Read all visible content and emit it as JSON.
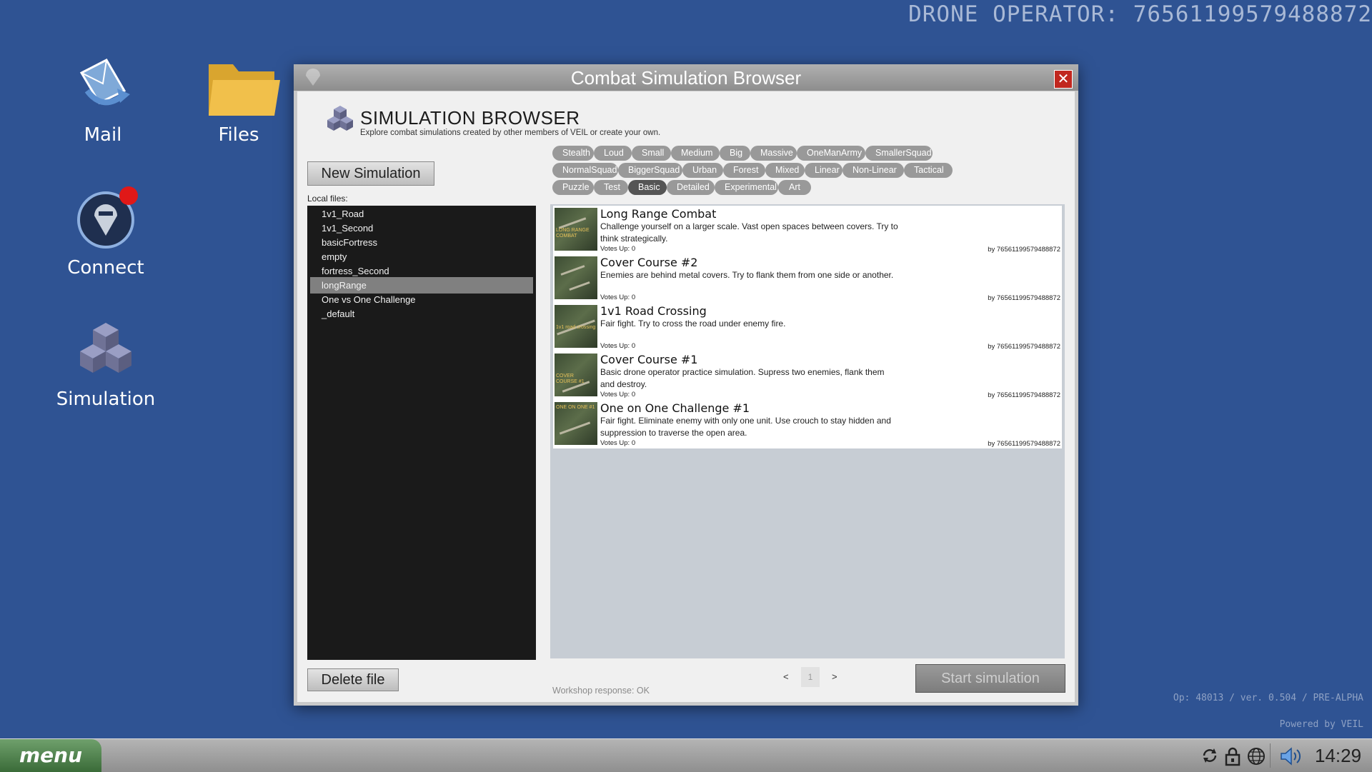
{
  "operator_id": "DRONE OPERATOR: 76561199579488872",
  "version_info": "Op: 48013 / ver. 0.504 / PRE-ALPHA",
  "powered_by": "Powered by VEIL",
  "desktop_icons": {
    "mail": "Mail",
    "files": "Files",
    "connect": "Connect",
    "simulation": "Simulation"
  },
  "window": {
    "title": "Combat Simulation Browser",
    "close_glyph": "✕",
    "header_title": "SIMULATION BROWSER",
    "header_subtitle": "Explore combat simulations created by other members of VEIL or create your own."
  },
  "new_simulation_label": "New Simulation",
  "local_files_label": "Local files:",
  "local_files": [
    "1v1_Road",
    "1v1_Second",
    "basicFortress",
    "empty",
    "fortress_Second",
    "longRange",
    "One vs One Challenge",
    "_default"
  ],
  "selected_file": "longRange",
  "tags": [
    "Stealth",
    "Loud",
    "Small",
    "Medium",
    "Big",
    "Massive",
    "OneManArmy",
    "SmallerSquad",
    "NormalSquad",
    "BiggerSquad",
    "Urban",
    "Forest",
    "Mixed",
    "Linear",
    "Non-Linear",
    "Tactical",
    "Puzzle",
    "Test",
    "Basic",
    "Detailed",
    "Experimental",
    "Art"
  ],
  "active_tag": "Basic",
  "results": [
    {
      "title": "Long Range Combat",
      "description": "Challenge yourself on a larger scale. Vast open spaces between covers. Try to think strategically.",
      "votes": "Votes Up: 0",
      "author": "by 76561199579488872",
      "thumb_text": "LONG RANGE COMBAT"
    },
    {
      "title": "Cover Course #2",
      "description": "Enemies are behind metal covers. Try to flank them from one side or another.",
      "votes": "Votes Up: 0",
      "author": "by 76561199579488872",
      "thumb_text": ""
    },
    {
      "title": "1v1 Road Crossing",
      "description": "Fair fight. Try to cross the road under enemy fire.",
      "votes": "Votes Up: 0",
      "author": "by 76561199579488872",
      "thumb_text": "1v1 road crossing"
    },
    {
      "title": "Cover Course #1",
      "description": "Basic drone operator practice simulation. Supress two enemies, flank them and destroy.",
      "votes": "Votes Up: 0",
      "author": "by 76561199579488872",
      "thumb_text": "COVER COURSE #1"
    },
    {
      "title": "One on One Challenge #1",
      "description": "Fair fight. Eliminate enemy with only one unit. Use crouch to stay hidden and suppression to traverse the open area.",
      "votes": "Votes Up: 0",
      "author": "by 76561199579488872",
      "thumb_text": "ONE ON ONE #1"
    }
  ],
  "delete_file_label": "Delete file",
  "workshop_status": "Workshop response: OK",
  "pager": {
    "prev": "<",
    "page": "1",
    "next": ">"
  },
  "start_simulation_label": "Start simulation",
  "taskbar": {
    "menu_label": "menu",
    "clock": "14:29"
  },
  "colors": {
    "desktop": "#2f5393",
    "window_frame": "#c9c9c9",
    "active_tag": "#555555",
    "close_button": "#c1271f",
    "menu_button": "#4f8a4c"
  }
}
